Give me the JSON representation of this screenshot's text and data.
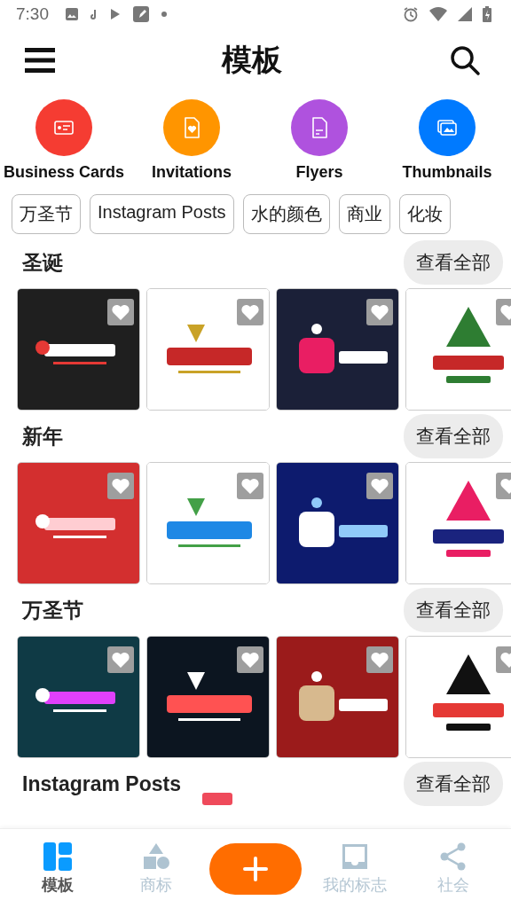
{
  "status_bar": {
    "time": "7:30"
  },
  "app_bar": {
    "title": "模板"
  },
  "categories": [
    {
      "label": "Business Cards",
      "color": "#f53c32",
      "kind": "card"
    },
    {
      "label": "Invitations",
      "color": "#ff9500",
      "kind": "invite"
    },
    {
      "label": "Flyers",
      "color": "#af52de",
      "kind": "flyer"
    },
    {
      "label": "Thumbnails",
      "color": "#007aff",
      "kind": "thumb"
    }
  ],
  "chips": [
    "万圣节",
    "Instagram Posts",
    "水的颜色",
    "商业",
    "化妆"
  ],
  "sections": [
    {
      "title": "圣诞",
      "view_all": "查看全部"
    },
    {
      "title": "新年",
      "view_all": "查看全部"
    },
    {
      "title": "万圣节",
      "view_all": "查看全部"
    },
    {
      "title": "Instagram Posts",
      "view_all": "查看全部",
      "badge": true
    }
  ],
  "bottom_nav": [
    {
      "kind": "tab",
      "label": "模板",
      "selected": true
    },
    {
      "kind": "tab",
      "label": "商标",
      "selected": false
    },
    {
      "kind": "add"
    },
    {
      "kind": "tab",
      "label": "我的标志",
      "selected": false
    },
    {
      "kind": "tab",
      "label": "社会",
      "selected": false
    }
  ]
}
